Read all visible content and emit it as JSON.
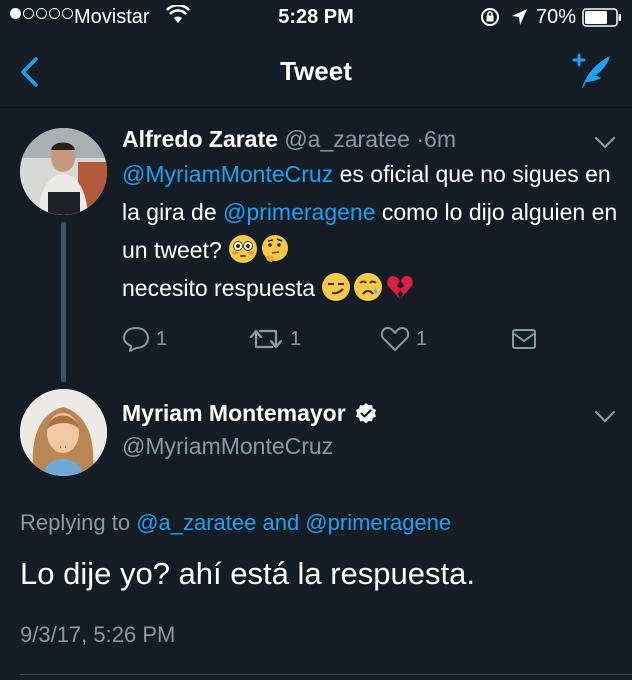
{
  "status_bar": {
    "carrier": "Movistar",
    "time": "5:28 PM",
    "battery": "70%"
  },
  "nav": {
    "title": "Tweet"
  },
  "parent_tweet": {
    "name": "Alfredo Zarate",
    "handle": "@a_zaratee",
    "separator": "·",
    "time_ago": "6m",
    "mention_1": "@MyriamMonteCruz",
    "text_1": " es oficial que no sigues en la gira de ",
    "mention_2": "@primeragene",
    "text_2": " como lo dijo alguien en un tweet? ",
    "text_3": "necesito respuesta ",
    "actions": {
      "reply_count": "1",
      "retweet_count": "1",
      "like_count": "1"
    }
  },
  "main_tweet": {
    "name": "Myriam Montemayor",
    "handle": "@MyriamMonteCruz",
    "replying_prefix": "Replying to ",
    "replying_to": "@a_zaratee and @primeragene",
    "text": "Lo dije yo? ahí está la respuesta.",
    "timestamp": "9/3/17, 5:26 PM"
  },
  "colors": {
    "background": "#141d26",
    "accent": "#1da1f2",
    "muted": "#8899a6"
  },
  "icons": [
    "back-chevron-icon",
    "compose-tweet-icon",
    "reply-icon",
    "retweet-icon",
    "like-icon",
    "dm-icon",
    "verified-badge-icon",
    "chevron-down-icon"
  ]
}
